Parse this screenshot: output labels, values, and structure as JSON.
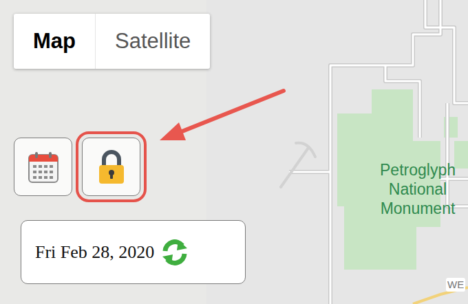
{
  "map_type_control": [
    {
      "label": "Map",
      "selected": true
    },
    {
      "label": "Satellite",
      "selected": false
    }
  ],
  "tool_buttons": [
    {
      "kind": "calendar",
      "highlighted": false
    },
    {
      "kind": "lock",
      "highlighted": true
    }
  ],
  "date_display": {
    "label": "Fri Feb 28, 2020"
  },
  "map_labels": [
    {
      "kind": "park",
      "text": "Petroglyph National Monument"
    },
    {
      "kind": "road",
      "text": "WE"
    }
  ]
}
